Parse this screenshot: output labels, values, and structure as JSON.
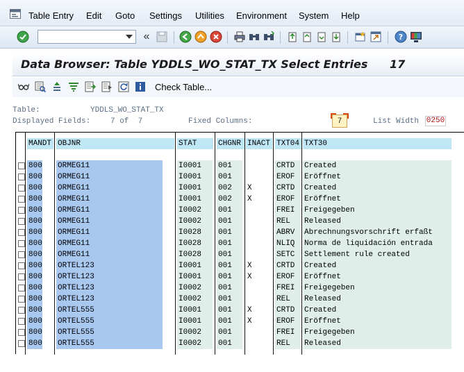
{
  "menu": [
    "Table Entry",
    "Edit",
    "Goto",
    "Settings",
    "Utilities",
    "Environment",
    "System",
    "Help"
  ],
  "command_field": {
    "value": ""
  },
  "title": {
    "text": "Data Browser: Table YDDLS_WO_STAT_TX Select Entries",
    "count": "17"
  },
  "app_toolbar": {
    "check_table_label": "Check Table..."
  },
  "info": {
    "table_label": "Table:",
    "table_value": "YDDLS_WO_STAT_TX",
    "displayed_label": "Displayed Fields:",
    "displayed_value": "7 of  7",
    "fixed_label": "Fixed Columns:",
    "fixed_value": "7",
    "list_width_label": "List Width",
    "list_width_value": "0250"
  },
  "table": {
    "columns": [
      "MANDT",
      "OBJNR",
      "STAT",
      "CHGNR",
      "INACT",
      "TXT04",
      "TXT30"
    ],
    "rows": [
      [
        "800",
        "ORMEG11",
        "I0001",
        "001",
        "",
        "CRTD",
        "Created"
      ],
      [
        "800",
        "ORMEG11",
        "I0001",
        "001",
        "",
        "EROF",
        "Eröffnet"
      ],
      [
        "800",
        "ORMEG11",
        "I0001",
        "002",
        "X",
        "CRTD",
        "Created"
      ],
      [
        "800",
        "ORMEG11",
        "I0001",
        "002",
        "X",
        "EROF",
        "Eröffnet"
      ],
      [
        "800",
        "ORMEG11",
        "I0002",
        "001",
        "",
        "FREI",
        "Freigegeben"
      ],
      [
        "800",
        "ORMEG11",
        "I0002",
        "001",
        "",
        "REL",
        "Released"
      ],
      [
        "800",
        "ORMEG11",
        "I0028",
        "001",
        "",
        "ABRV",
        "Abrechnungsvorschrift erfaßt"
      ],
      [
        "800",
        "ORMEG11",
        "I0028",
        "001",
        "",
        "NLIQ",
        "Norma de liquidación entrada"
      ],
      [
        "800",
        "ORMEG11",
        "I0028",
        "001",
        "",
        "SETC",
        "Settlement rule created"
      ],
      [
        "800",
        "ORTEL123",
        "I0001",
        "001",
        "X",
        "CRTD",
        "Created"
      ],
      [
        "800",
        "ORTEL123",
        "I0001",
        "001",
        "X",
        "EROF",
        "Eröffnet"
      ],
      [
        "800",
        "ORTEL123",
        "I0002",
        "001",
        "",
        "FREI",
        "Freigegeben"
      ],
      [
        "800",
        "ORTEL123",
        "I0002",
        "001",
        "",
        "REL",
        "Released"
      ],
      [
        "800",
        "ORTEL555",
        "I0001",
        "001",
        "X",
        "CRTD",
        "Created"
      ],
      [
        "800",
        "ORTEL555",
        "I0001",
        "001",
        "X",
        "EROF",
        "Eröffnet"
      ],
      [
        "800",
        "ORTEL555",
        "I0002",
        "001",
        "",
        "FREI",
        "Freigegeben"
      ],
      [
        "800",
        "ORTEL555",
        "I0002",
        "001",
        "",
        "REL",
        "Released"
      ]
    ]
  }
}
